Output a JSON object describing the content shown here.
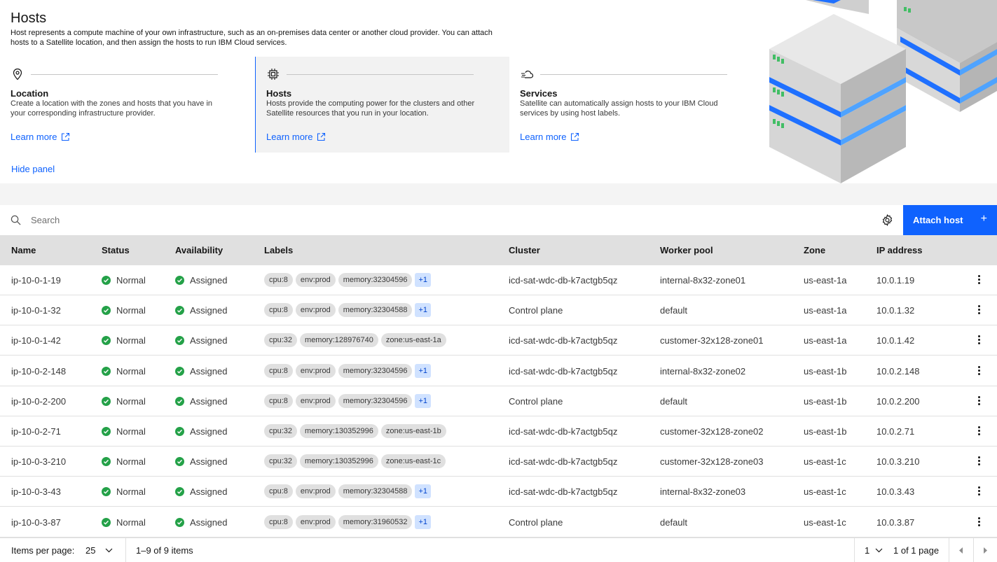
{
  "intro": {
    "title": "Hosts",
    "description": "Host represents a compute machine of your own infrastructure, such as an on-premises data center or another cloud provider. You can attach hosts to a Satellite location, and then assign the hosts to run IBM Cloud services.",
    "cards": [
      {
        "title": "Location",
        "description": "Create a location with the zones and hosts that you have in your corresponding infrastructure provider.",
        "link": "Learn more",
        "icon": "location-pin-icon"
      },
      {
        "title": "Hosts",
        "description": "Hosts provide the computing power for the clusters and other Satellite resources that you run in your location.",
        "link": "Learn more",
        "icon": "chip-icon"
      },
      {
        "title": "Services",
        "description": "Satellite can automatically assign hosts to your IBM Cloud services by using host labels.",
        "link": "Learn more",
        "icon": "cloud-services-icon"
      }
    ],
    "hide_panel": "Hide panel"
  },
  "toolbar": {
    "search_placeholder": "Search",
    "attach_label": "Attach host",
    "attach_icon": "+"
  },
  "table": {
    "columns": [
      "Name",
      "Status",
      "Availability",
      "Labels",
      "Cluster",
      "Worker pool",
      "Zone",
      "IP address"
    ],
    "rows": [
      {
        "name": "ip-10-0-1-19",
        "status": "Normal",
        "availability": "Assigned",
        "labels": [
          "cpu:8",
          "env:prod",
          "memory:32304596"
        ],
        "more": "+1",
        "cluster": "icd-sat-wdc-db-k7actgb5qz",
        "pool": "internal-8x32-zone01",
        "zone": "us-east-1a",
        "ip": "10.0.1.19"
      },
      {
        "name": "ip-10-0-1-32",
        "status": "Normal",
        "availability": "Assigned",
        "labels": [
          "cpu:8",
          "env:prod",
          "memory:32304588"
        ],
        "more": "+1",
        "cluster": "Control plane",
        "pool": "default",
        "zone": "us-east-1a",
        "ip": "10.0.1.32"
      },
      {
        "name": "ip-10-0-1-42",
        "status": "Normal",
        "availability": "Assigned",
        "labels": [
          "cpu:32",
          "memory:128976740",
          "zone:us-east-1a"
        ],
        "more": "",
        "cluster": "icd-sat-wdc-db-k7actgb5qz",
        "pool": "customer-32x128-zone01",
        "zone": "us-east-1a",
        "ip": "10.0.1.42"
      },
      {
        "name": "ip-10-0-2-148",
        "status": "Normal",
        "availability": "Assigned",
        "labels": [
          "cpu:8",
          "env:prod",
          "memory:32304596"
        ],
        "more": "+1",
        "cluster": "icd-sat-wdc-db-k7actgb5qz",
        "pool": "internal-8x32-zone02",
        "zone": "us-east-1b",
        "ip": "10.0.2.148"
      },
      {
        "name": "ip-10-0-2-200",
        "status": "Normal",
        "availability": "Assigned",
        "labels": [
          "cpu:8",
          "env:prod",
          "memory:32304596"
        ],
        "more": "+1",
        "cluster": "Control plane",
        "pool": "default",
        "zone": "us-east-1b",
        "ip": "10.0.2.200"
      },
      {
        "name": "ip-10-0-2-71",
        "status": "Normal",
        "availability": "Assigned",
        "labels": [
          "cpu:32",
          "memory:130352996",
          "zone:us-east-1b"
        ],
        "more": "",
        "cluster": "icd-sat-wdc-db-k7actgb5qz",
        "pool": "customer-32x128-zone02",
        "zone": "us-east-1b",
        "ip": "10.0.2.71"
      },
      {
        "name": "ip-10-0-3-210",
        "status": "Normal",
        "availability": "Assigned",
        "labels": [
          "cpu:32",
          "memory:130352996",
          "zone:us-east-1c"
        ],
        "more": "",
        "cluster": "icd-sat-wdc-db-k7actgb5qz",
        "pool": "customer-32x128-zone03",
        "zone": "us-east-1c",
        "ip": "10.0.3.210"
      },
      {
        "name": "ip-10-0-3-43",
        "status": "Normal",
        "availability": "Assigned",
        "labels": [
          "cpu:8",
          "env:prod",
          "memory:32304588"
        ],
        "more": "+1",
        "cluster": "icd-sat-wdc-db-k7actgb5qz",
        "pool": "internal-8x32-zone03",
        "zone": "us-east-1c",
        "ip": "10.0.3.43"
      },
      {
        "name": "ip-10-0-3-87",
        "status": "Normal",
        "availability": "Assigned",
        "labels": [
          "cpu:8",
          "env:prod",
          "memory:31960532"
        ],
        "more": "+1",
        "cluster": "Control plane",
        "pool": "default",
        "zone": "us-east-1c",
        "ip": "10.0.3.87"
      }
    ]
  },
  "pagination": {
    "items_per_page_label": "Items per page:",
    "items_per_page": "25",
    "range": "1–9 of 9 items",
    "page": "1",
    "page_of": "1 of 1 page"
  },
  "colors": {
    "accent": "#0f62fe",
    "success": "#24a148",
    "tag_bg": "#e0e0e0",
    "more_tag_bg": "#d0e2ff"
  }
}
